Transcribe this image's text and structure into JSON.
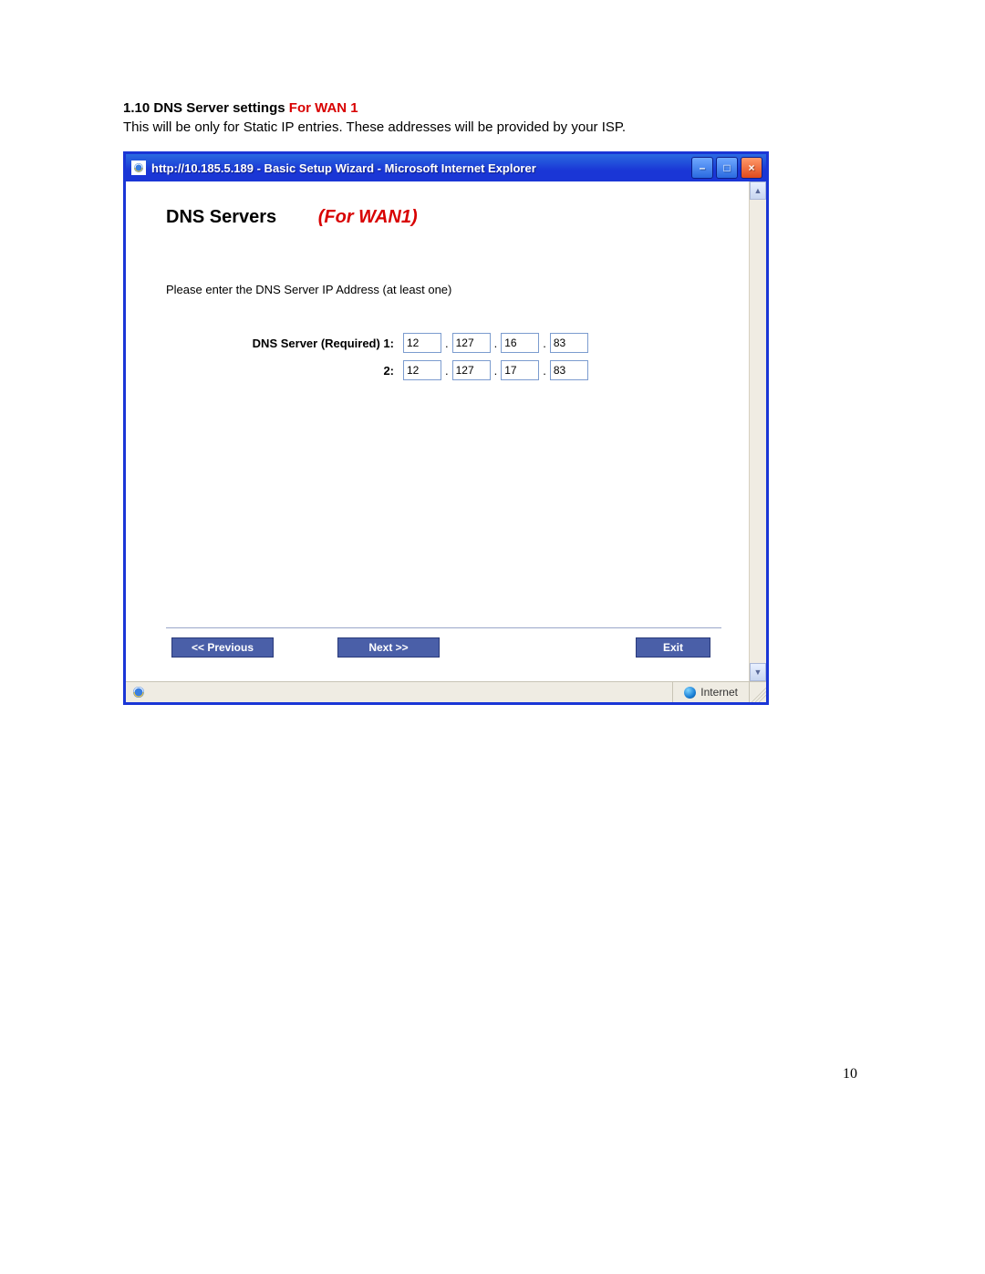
{
  "doc": {
    "heading_num": "1.10",
    "heading_black": "DNS Server settings",
    "heading_red": "For WAN 1",
    "subtext": "This will be only for Static IP entries. These addresses will be provided by your ISP.",
    "page_number": "10"
  },
  "window": {
    "title": "http://10.185.5.189 - Basic Setup Wizard - Microsoft Internet Explorer",
    "controls": {
      "minimize": "–",
      "maximize": "□",
      "close": "×"
    }
  },
  "content": {
    "title_black": "DNS Servers",
    "title_red": "(For WAN1)",
    "instruction": "Please enter the DNS Server IP Address (at least one)",
    "label_1": "DNS Server (Required) 1:",
    "label_2": "2:",
    "dns1": {
      "a": "12",
      "b": "127",
      "c": "16",
      "d": "83"
    },
    "dns2": {
      "a": "12",
      "b": "127",
      "c": "17",
      "d": "83"
    },
    "dot": "."
  },
  "buttons": {
    "previous": "<< Previous",
    "next": "Next >>",
    "exit": "Exit"
  },
  "scrollbar": {
    "up": "▲",
    "down": "▼"
  },
  "status": {
    "zone": "Internet"
  }
}
